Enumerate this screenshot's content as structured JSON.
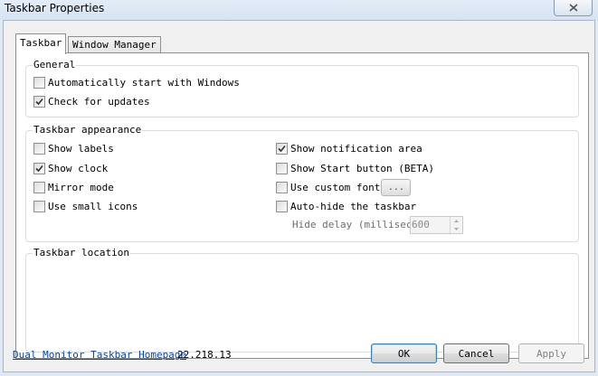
{
  "window": {
    "title": "Taskbar Properties"
  },
  "tabs": [
    {
      "label": "Taskbar",
      "active": true
    },
    {
      "label": "Window Manager",
      "active": false
    }
  ],
  "general": {
    "title": "General",
    "auto_start": {
      "label": "Automatically start with Windows",
      "checked": false
    },
    "check_updates": {
      "label": "Check for updates",
      "checked": true
    }
  },
  "appearance": {
    "title": "Taskbar appearance",
    "show_labels": {
      "label": "Show labels",
      "checked": false
    },
    "show_clock": {
      "label": "Show clock",
      "checked": true
    },
    "mirror_mode": {
      "label": "Mirror mode",
      "checked": false
    },
    "small_icons": {
      "label": "Use small icons",
      "checked": false
    },
    "show_notification": {
      "label": "Show notification area",
      "checked": true
    },
    "show_start": {
      "label": "Show Start button (BETA)",
      "checked": false
    },
    "custom_font": {
      "label": "Use custom font",
      "checked": false,
      "button": "..."
    },
    "auto_hide": {
      "label": "Auto-hide the taskbar",
      "checked": false
    },
    "hide_delay": {
      "label": "Hide delay (millisecor",
      "value": "600"
    }
  },
  "location": {
    "title": "Taskbar location"
  },
  "footer": {
    "homepage_link": "Dual Monitor Taskbar Homepage",
    "version": "22.218.13",
    "ok": "OK",
    "cancel": "Cancel",
    "apply": "Apply"
  },
  "colors": {
    "link": "#0645ad",
    "check": "#333333",
    "titlebar": "#dfe9f4"
  }
}
